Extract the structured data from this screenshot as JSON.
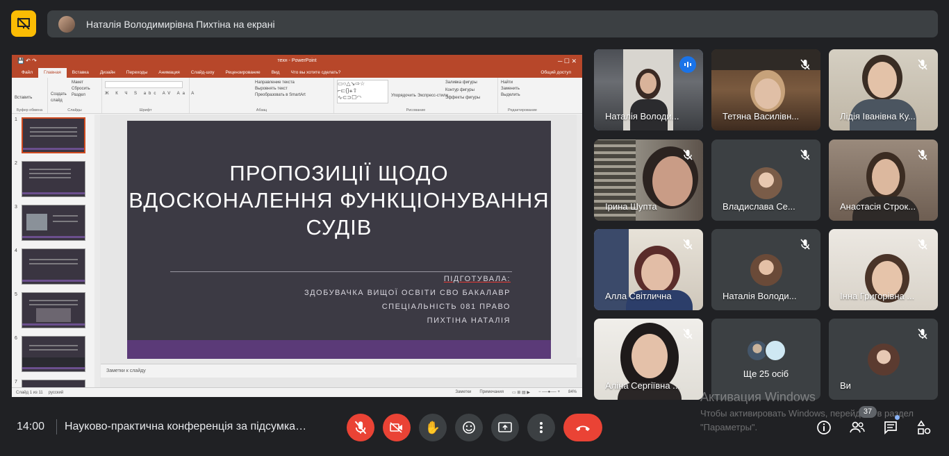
{
  "banner": {
    "text": "Наталія Володимирівна Пихтіна на екрані"
  },
  "ppt": {
    "window_title": "техн - PowerPoint",
    "tabs": [
      "Файл",
      "Главная",
      "Вставка",
      "Дизайн",
      "Переходы",
      "Анимация",
      "Слайд-шоу",
      "Рецензирование",
      "Вид",
      "Что вы хотите сделать?"
    ],
    "share": "Общий доступ",
    "groups": {
      "clipboard": "Буфер обмена",
      "slides": "Слайды",
      "font": "Шрифт",
      "paragraph": "Абзац",
      "drawing": "Рисование",
      "editing": "Редактирование"
    },
    "ribbon": {
      "paste": "Вставить",
      "new_slide": "Создать слайд",
      "layout": "Макет",
      "reset": "Сбросить",
      "section": "Раздел",
      "text_dir": "Направление текста",
      "align_text": "Выровнять текст",
      "smartart": "Преобразовать в SmartArt",
      "arrange": "Упорядочить",
      "quick_styles": "Экспресс-стили",
      "fill": "Заливка фигуры",
      "outline": "Контур фигуры",
      "effects": "Эффекты фигуры",
      "find": "Найти",
      "replace": "Заменить",
      "select": "Выделить"
    },
    "slide_numbers": [
      "1",
      "2",
      "3",
      "4",
      "5",
      "6",
      "7"
    ],
    "slide": {
      "title": "ПРОПОЗИЦІЇ ЩОДО ВДОСКОНАЛЕННЯ ФУНКЦІОНУВАННЯ СУДІВ",
      "line1": "ПІДГОТУВАЛА:",
      "line2": "ЗДОБУВАЧКА ВИЩОЇ ОСВІТИ СВО БАКАЛАВР",
      "line3": "СПЕЦІАЛЬНІСТЬ 081 ПРАВО",
      "line4": "ПИХТІНА НАТАЛІЯ"
    },
    "notes": "Заметки к слайду",
    "status": {
      "slide_of": "Слайд 1 из 11",
      "language": "русский",
      "notes_btn": "Заметки",
      "comments_btn": "Примечания",
      "zoom": "84%"
    }
  },
  "participants": [
    {
      "name": "Наталія Володи...",
      "talking": true
    },
    {
      "name": "Тетяна Василівн...",
      "talking": false
    },
    {
      "name": "Лідія Іванівна Ку...",
      "talking": false
    },
    {
      "name": "Ірина Шупта",
      "talking": false
    },
    {
      "name": "Владислава Се...",
      "talking": false
    },
    {
      "name": "Анастасія Строк...",
      "talking": false
    },
    {
      "name": "Алла Світлична",
      "talking": false
    },
    {
      "name": "Наталія Володи...",
      "talking": false
    },
    {
      "name": "Інна Григорівна ...",
      "talking": false
    },
    {
      "name": "Аліна Сергіївна ...",
      "talking": false
    },
    {
      "name": "Ще 25 осіб",
      "talking": false
    },
    {
      "name": "Ви",
      "talking": false
    }
  ],
  "bottom": {
    "time": "14:00",
    "meeting_title": "Науково-практична конференція за підсумками",
    "participants_count": "37"
  },
  "watermark": {
    "title": "Активация Windows",
    "text": "Чтобы активировать Windows, перейдите в раздел \"Параметры\"."
  },
  "colors": {
    "accent": "#8ab4f8",
    "end_call": "#ea4335",
    "presenting": "#fbbc04",
    "ppt": "#b7472a"
  }
}
